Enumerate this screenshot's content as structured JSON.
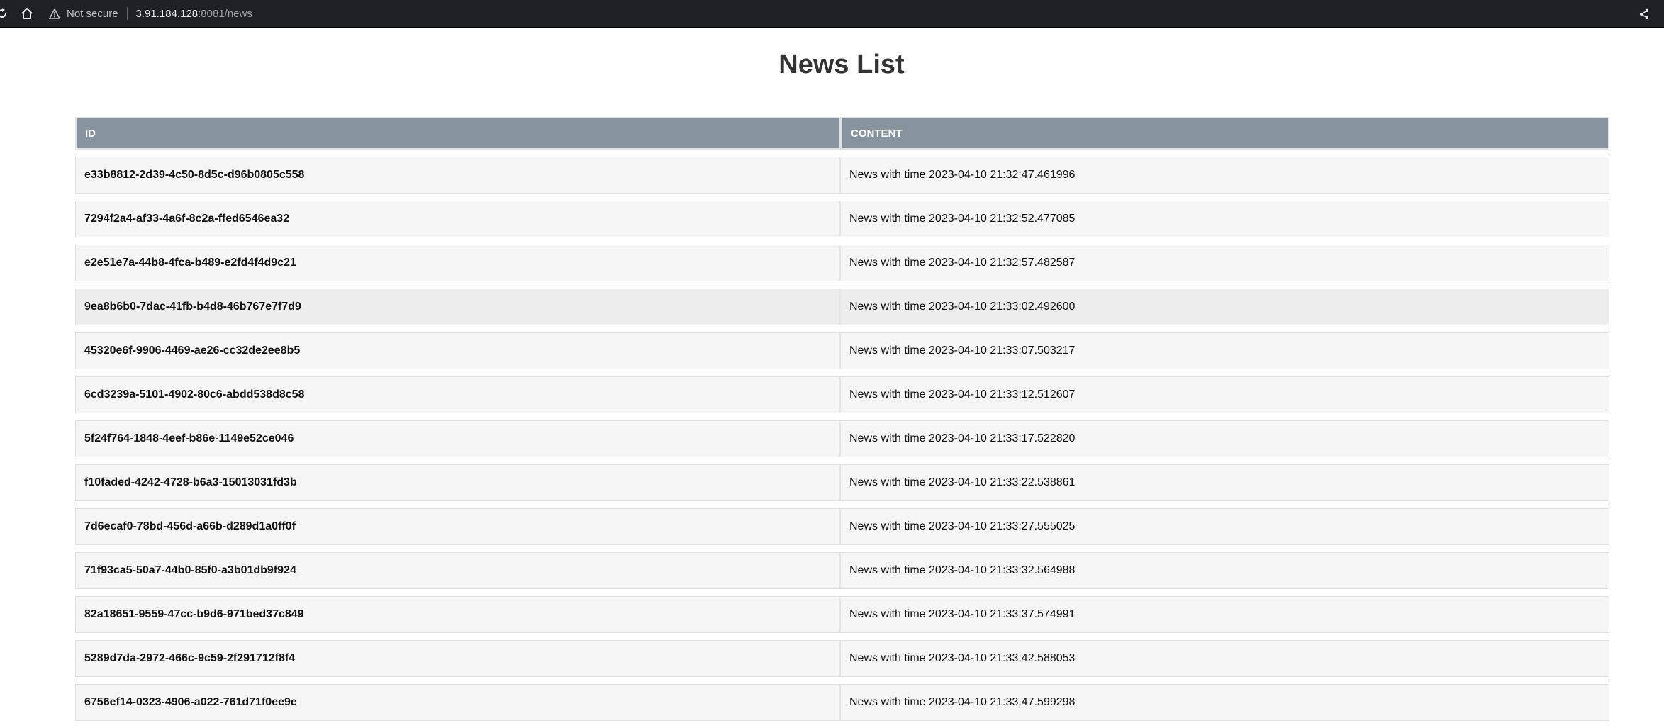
{
  "browser": {
    "security_label": "Not secure",
    "url_host": "3.91.184.128",
    "url_path": ":8081/news"
  },
  "page": {
    "title": "News List"
  },
  "table": {
    "columns": [
      "ID",
      "CONTENT"
    ],
    "rows": [
      {
        "id": "e33b8812-2d39-4c50-8d5c-d96b0805c558",
        "content": "News with time 2023-04-10 21:32:47.461996"
      },
      {
        "id": "7294f2a4-af33-4a6f-8c2a-ffed6546ea32",
        "content": "News with time 2023-04-10 21:32:52.477085"
      },
      {
        "id": "e2e51e7a-44b8-4fca-b489-e2fd4f4d9c21",
        "content": "News with time 2023-04-10 21:32:57.482587"
      },
      {
        "id": "9ea8b6b0-7dac-41fb-b4d8-46b767e7f7d9",
        "content": "News with time 2023-04-10 21:33:02.492600"
      },
      {
        "id": "45320e6f-9906-4469-ae26-cc32de2ee8b5",
        "content": "News with time 2023-04-10 21:33:07.503217"
      },
      {
        "id": "6cd3239a-5101-4902-80c6-abdd538d8c58",
        "content": "News with time 2023-04-10 21:33:12.512607"
      },
      {
        "id": "5f24f764-1848-4eef-b86e-1149e52ce046",
        "content": "News with time 2023-04-10 21:33:17.522820"
      },
      {
        "id": "f10faded-4242-4728-b6a3-15013031fd3b",
        "content": "News with time 2023-04-10 21:33:22.538861"
      },
      {
        "id": "7d6ecaf0-78bd-456d-a66b-d289d1a0ff0f",
        "content": "News with time 2023-04-10 21:33:27.555025"
      },
      {
        "id": "71f93ca5-50a7-44b0-85f0-a3b01db9f924",
        "content": "News with time 2023-04-10 21:33:32.564988"
      },
      {
        "id": "82a18651-9559-47cc-b9d6-971bed37c849",
        "content": "News with time 2023-04-10 21:33:37.574991"
      },
      {
        "id": "5289d7da-2972-466c-9c59-2f291712f8f4",
        "content": "News with time 2023-04-10 21:33:42.588053"
      },
      {
        "id": "6756ef14-0323-4906-a022-761d71f0ee9e",
        "content": "News with time 2023-04-10 21:33:47.599298"
      }
    ]
  }
}
